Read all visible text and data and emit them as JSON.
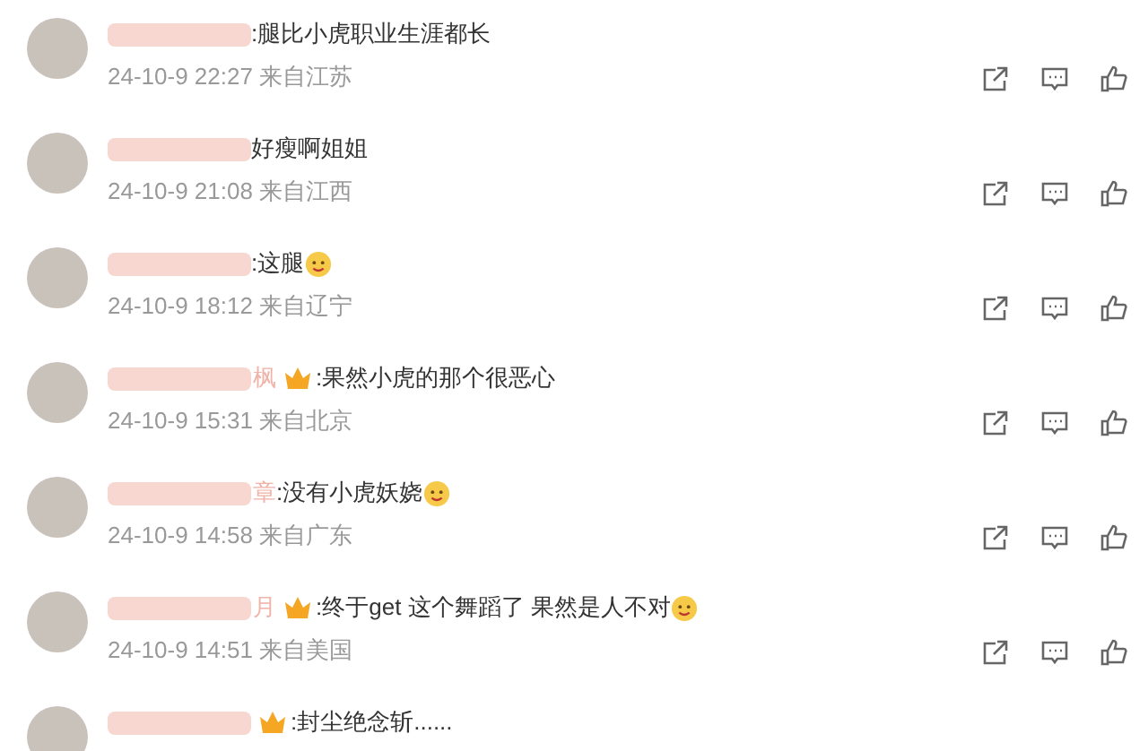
{
  "comments": [
    {
      "badge": false,
      "text": ":腿比小虎职业生涯都长",
      "emoji": false,
      "time": "24-10-9 22:27 来自江苏"
    },
    {
      "badge": false,
      "text": "好瘦啊姐姐",
      "emoji": false,
      "time": "24-10-9 21:08 来自江西"
    },
    {
      "badge": false,
      "text": ":这腿",
      "emoji": true,
      "time": "24-10-9 18:12 来自辽宁"
    },
    {
      "name_tail": "枫",
      "badge": true,
      "text": ":果然小虎的那个很恶心",
      "emoji": false,
      "time": "24-10-9 15:31 来自北京"
    },
    {
      "name_tail": "章",
      "badge": false,
      "text": ":没有小虎妖娆",
      "emoji": true,
      "time": "24-10-9 14:58 来自广东"
    },
    {
      "name_tail": "月",
      "badge": true,
      "text": ":终于get 这个舞蹈了 果然是人不对",
      "emoji": true,
      "time": "24-10-9 14:51 来自美国"
    },
    {
      "badge": true,
      "text": ":封尘绝念斩......",
      "emoji": false
    }
  ]
}
